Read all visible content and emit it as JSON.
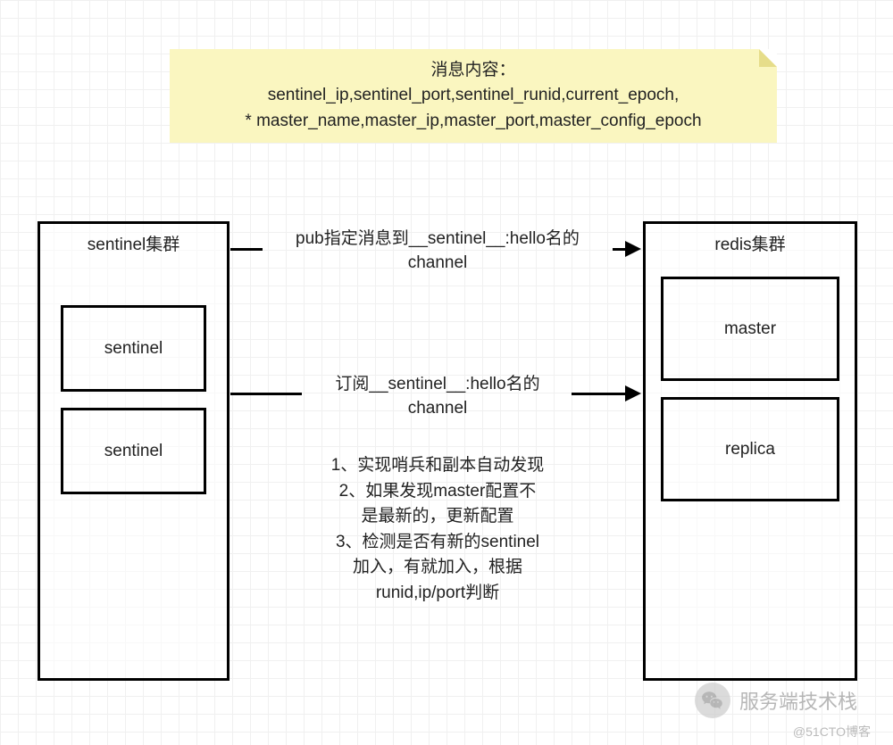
{
  "note": {
    "title": "消息内容：",
    "line1": "sentinel_ip,sentinel_port,sentinel_runid,current_epoch,",
    "line2": "* master_name,master_ip,master_port,master_config_epoch"
  },
  "sentinel_cluster": {
    "title": "sentinel集群",
    "nodes": [
      "sentinel",
      "sentinel"
    ]
  },
  "redis_cluster": {
    "title": "redis集群",
    "nodes": [
      "master",
      "replica"
    ]
  },
  "arrows": {
    "top": {
      "line1": "pub指定消息到__sentinel__:hello名的",
      "line2": "channel"
    },
    "bottom": {
      "line1": "订阅__sentinel__:hello名的",
      "line2": "channel"
    }
  },
  "notes_list": {
    "item1": "1、实现哨兵和副本自动发现",
    "item2a": "2、如果发现master配置不",
    "item2b": "是最新的，更新配置",
    "item3a": "3、检测是否有新的sentinel",
    "item3b": "加入，有就加入，根据",
    "item3c": "runid,ip/port判断"
  },
  "watermark": {
    "text": "服务端技术栈",
    "attribution": "@51CTO博客"
  }
}
